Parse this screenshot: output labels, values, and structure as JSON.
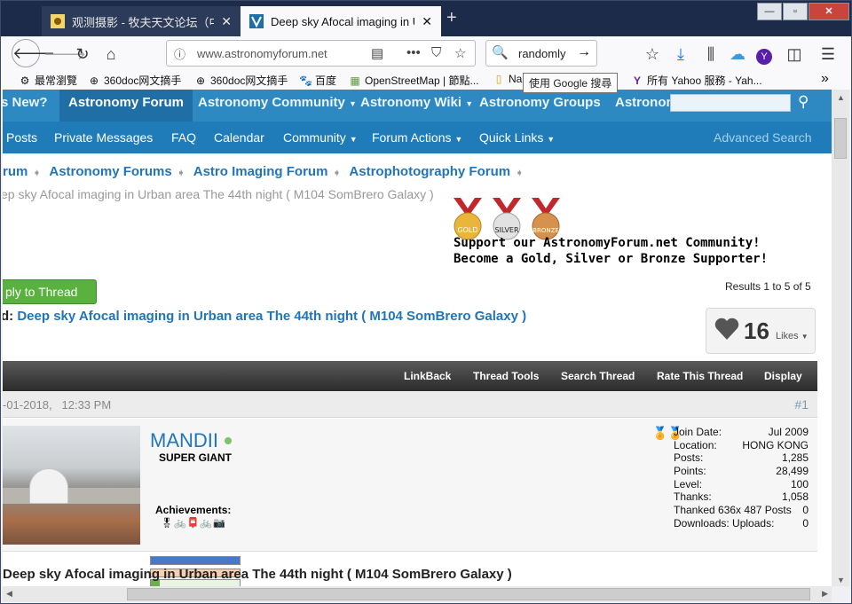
{
  "tabs": [
    {
      "title": "观测摄影 - 牧夫天文论坛（中国",
      "active": false
    },
    {
      "title": "Deep sky Afocal imaging in Urb",
      "active": true
    }
  ],
  "window": {
    "minimize": "—",
    "restore": "▫",
    "close": "✕"
  },
  "navbar": {
    "url": "www.astronomyforum.net",
    "search_value": "randomly"
  },
  "tooltip": "使用 Google 搜尋",
  "bookmarks": [
    {
      "label": "最常瀏覽",
      "icon": "gear-icon"
    },
    {
      "label": "360doc网文摘手",
      "icon": "globe-icon"
    },
    {
      "label": "360doc网文摘手",
      "icon": "globe-icon"
    },
    {
      "label": "百度",
      "icon": "baidu-paw-icon"
    },
    {
      "label": "OpenStreetMap | 節點...",
      "icon": "osm-icon"
    },
    {
      "label": "Na",
      "icon": "note-icon"
    },
    {
      "label": "所有 Yahoo 服務 - Yah...",
      "icon": "yahoo-icon"
    }
  ],
  "site": {
    "top_nav": [
      "s New?",
      "Astronomy Forum",
      "Astronomy Community",
      "Astronomy Wiki",
      "Astronomy Groups",
      "Astronon"
    ],
    "sub_nav": [
      "Posts",
      "Private Messages",
      "FAQ",
      "Calendar",
      "Community",
      "Forum Actions",
      "Quick Links"
    ],
    "advanced_search": "Advanced Search",
    "breadcrumbs": [
      "rum",
      "Astronomy Forums",
      "Astro Imaging Forum",
      "Astrophotography Forum"
    ],
    "breadcrumb_title": "ep sky Afocal imaging in Urban area The 44th night ( M104 SomBrero Galaxy )",
    "medals": {
      "gold": "GOLD",
      "silver": "SILVER",
      "bronze": "BRONZE"
    },
    "support_line1": "Support our AstronomyForum.net Community!",
    "support_line2": "Become a Gold, Silver or Bronze Supporter!",
    "reply_button": "ply to Thread",
    "results": "Results 1 to 5 of 5",
    "thread_prefix": "d:",
    "thread_title": "Deep sky Afocal imaging in Urban area The 44th night ( M104 SomBrero Galaxy )",
    "likes_count": "16",
    "likes_label": "Likes",
    "toolbar": [
      "LinkBack",
      "Thread Tools",
      "Search Thread",
      "Rate This Thread",
      "Display"
    ],
    "post": {
      "date": "-01-2018,",
      "time": "12:33 PM",
      "number": "#1",
      "username": "MANDII",
      "rank": "SUPER GIANT",
      "achievements_label": "Achievements:",
      "stats": [
        {
          "label": "Join Date:",
          "value": "Jul 2009"
        },
        {
          "label": "Location:",
          "value": "HONG KONG"
        },
        {
          "label": "Posts:",
          "value": "1,285"
        },
        {
          "label": "Points:",
          "value": "28,499"
        },
        {
          "label": "Level:",
          "value": "100"
        },
        {
          "label": "Thanks:",
          "value": "1,058"
        },
        {
          "label": "Thanked 636x 487 Posts",
          "value": "0"
        },
        {
          "label": "Downloads: Uploads:",
          "value": "0"
        }
      ],
      "title": "Deep sky Afocal imaging in Urban area The 44th night ( M104 SomBrero Galaxy )"
    }
  }
}
